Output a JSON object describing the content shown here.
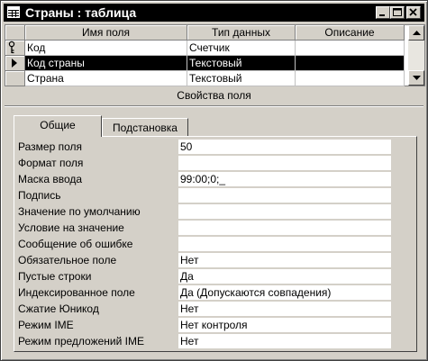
{
  "window": {
    "title": "Страны : таблица"
  },
  "grid": {
    "headers": [
      "Имя поля",
      "Тип данных",
      "Описание"
    ],
    "rows": [
      {
        "name": "Код",
        "type": "Счетчик",
        "desc": "",
        "indicator": "key"
      },
      {
        "name": "Код страны",
        "type": "Текстовый",
        "desc": "",
        "indicator": "current"
      },
      {
        "name": "Страна",
        "type": "Текстовый",
        "desc": "",
        "indicator": ""
      }
    ]
  },
  "properties": {
    "title": "Свойства поля",
    "tabs": [
      "Общие",
      "Подстановка"
    ],
    "active_tab": "Общие",
    "items": [
      {
        "label": "Размер поля",
        "value": "50"
      },
      {
        "label": "Формат поля",
        "value": ""
      },
      {
        "label": "Маска ввода",
        "value": "99:00;0;_"
      },
      {
        "label": "Подпись",
        "value": ""
      },
      {
        "label": "Значение по умолчанию",
        "value": ""
      },
      {
        "label": "Условие на значение",
        "value": ""
      },
      {
        "label": "Сообщение об ошибке",
        "value": ""
      },
      {
        "label": "Обязательное поле",
        "value": "Нет"
      },
      {
        "label": "Пустые строки",
        "value": "Да"
      },
      {
        "label": "Индексированное поле",
        "value": "Да (Допускаются совпадения)"
      },
      {
        "label": "Сжатие Юникод",
        "value": "Нет"
      },
      {
        "label": "Режим IME",
        "value": "Нет контроля"
      },
      {
        "label": "Режим предложений IME",
        "value": "Нет"
      }
    ]
  }
}
